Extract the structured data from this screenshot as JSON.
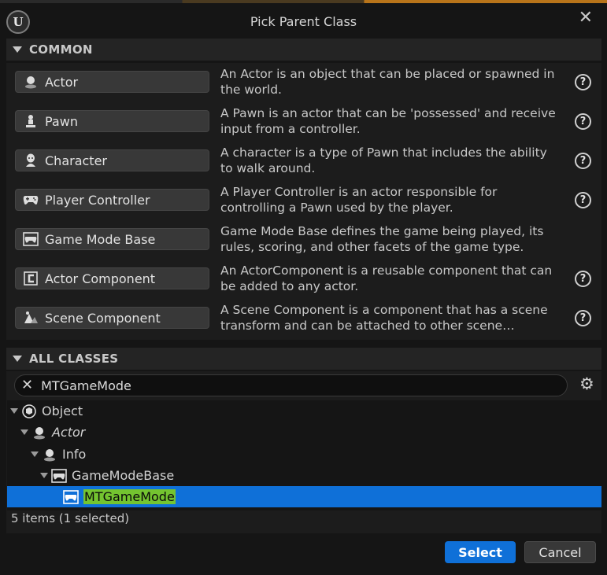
{
  "window": {
    "title": "Pick Parent Class"
  },
  "common": {
    "header": "COMMON",
    "items": [
      {
        "label": "Actor",
        "icon": "actor-icon",
        "description": "An Actor is an object that can be placed or spawned in the world.",
        "has_help": true
      },
      {
        "label": "Pawn",
        "icon": "pawn-icon",
        "description": "A Pawn is an actor that can be 'possessed' and receive input from a controller.",
        "has_help": true
      },
      {
        "label": "Character",
        "icon": "character-icon",
        "description": "A character is a type of Pawn that includes the ability to walk around.",
        "has_help": true
      },
      {
        "label": "Player Controller",
        "icon": "gamepad-icon",
        "description": "A Player Controller is an actor responsible for controlling a Pawn used by the player.",
        "has_help": true
      },
      {
        "label": "Game Mode Base",
        "icon": "game-mode-icon",
        "description": "Game Mode Base defines the game being played, its rules, scoring, and other facets of the game type.",
        "has_help": false
      },
      {
        "label": "Actor Component",
        "icon": "actor-component-icon",
        "description": "An ActorComponent is a reusable component that can be added to any actor.",
        "has_help": true
      },
      {
        "label": "Scene Component",
        "icon": "scene-component-icon",
        "description": "A Scene Component is a component that has a scene transform and can be attached to other scene…",
        "has_help": true
      }
    ]
  },
  "all_classes": {
    "header": "ALL CLASSES",
    "search_value": "MTGameMode",
    "tree": [
      {
        "label": "Object",
        "icon": "object-icon",
        "expanded": true,
        "italic": false,
        "selected": false
      },
      {
        "label": "Actor",
        "icon": "actor-icon",
        "expanded": true,
        "italic": true,
        "selected": false
      },
      {
        "label": "Info",
        "icon": "actor-icon",
        "expanded": true,
        "italic": false,
        "selected": false
      },
      {
        "label": "GameModeBase",
        "icon": "game-mode-icon",
        "expanded": true,
        "italic": false,
        "selected": false
      },
      {
        "label": "MTGameMode",
        "icon": "game-mode-icon",
        "expanded": false,
        "italic": false,
        "selected": true
      }
    ],
    "status": "5 items (1 selected)"
  },
  "footer": {
    "select_label": "Select",
    "cancel_label": "Cancel"
  },
  "colors": {
    "accent": "#0f70d8",
    "highlight": "#74c430",
    "background": "#151515"
  }
}
